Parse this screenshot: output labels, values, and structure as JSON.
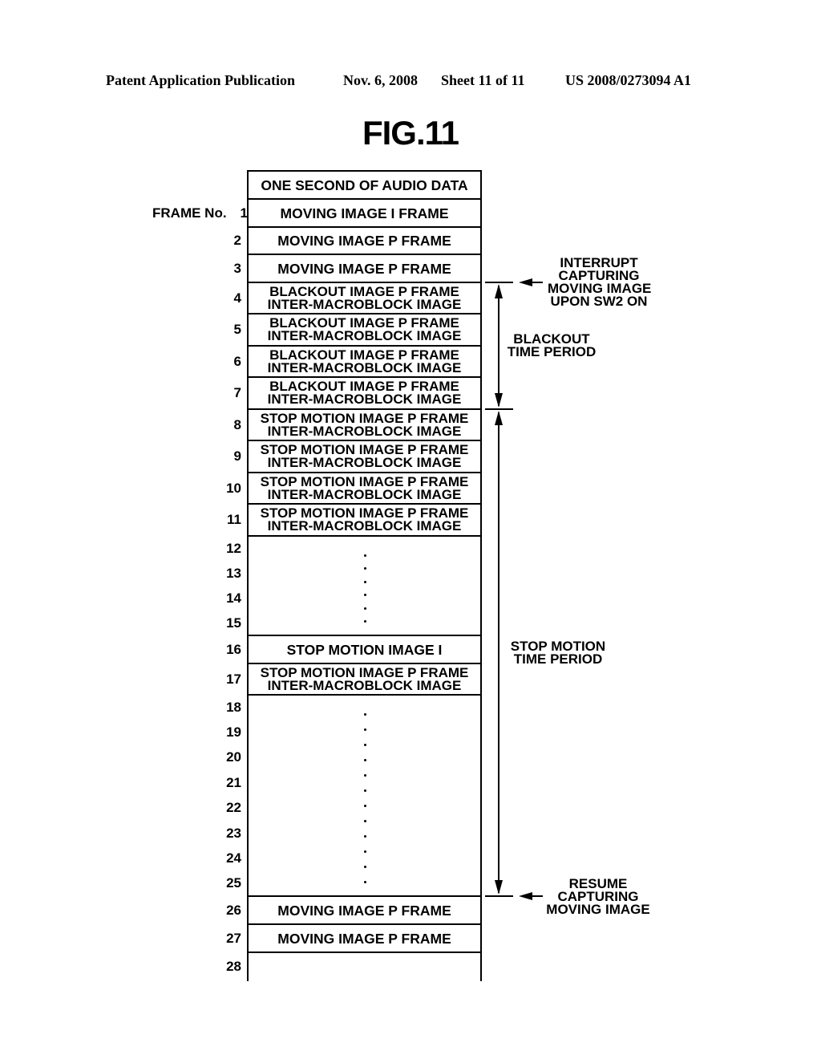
{
  "header": {
    "publication": "Patent Application Publication",
    "date": "Nov. 6, 2008",
    "sheet": "Sheet 11 of 11",
    "number": "US 2008/0273094 A1"
  },
  "figure": {
    "title": "FIG.11",
    "frame_label": "FRAME No.",
    "top_cell": "ONE SECOND OF AUDIO DATA",
    "rows": [
      {
        "frames": [
          "1"
        ],
        "lines": [
          "MOVING IMAGE I FRAME"
        ]
      },
      {
        "frames": [
          "2"
        ],
        "lines": [
          "MOVING IMAGE P FRAME"
        ]
      },
      {
        "frames": [
          "3"
        ],
        "lines": [
          "MOVING IMAGE P FRAME"
        ]
      },
      {
        "frames": [
          "4"
        ],
        "lines": [
          "BLACKOUT IMAGE P FRAME",
          "INTER-MACROBLOCK IMAGE"
        ]
      },
      {
        "frames": [
          "5"
        ],
        "lines": [
          "BLACKOUT IMAGE P FRAME",
          "INTER-MACROBLOCK IMAGE"
        ]
      },
      {
        "frames": [
          "6"
        ],
        "lines": [
          "BLACKOUT IMAGE P FRAME",
          "INTER-MACROBLOCK IMAGE"
        ]
      },
      {
        "frames": [
          "7"
        ],
        "lines": [
          "BLACKOUT IMAGE P FRAME",
          "INTER-MACROBLOCK IMAGE"
        ]
      },
      {
        "frames": [
          "8"
        ],
        "lines": [
          "STOP MOTION IMAGE P FRAME",
          "INTER-MACROBLOCK IMAGE"
        ]
      },
      {
        "frames": [
          "9"
        ],
        "lines": [
          "STOP MOTION IMAGE P FRAME",
          "INTER-MACROBLOCK IMAGE"
        ]
      },
      {
        "frames": [
          "10"
        ],
        "lines": [
          "STOP MOTION IMAGE P FRAME",
          "INTER-MACROBLOCK IMAGE"
        ]
      },
      {
        "frames": [
          "11"
        ],
        "lines": [
          "STOP MOTION IMAGE P FRAME",
          "INTER-MACROBLOCK IMAGE"
        ]
      },
      {
        "frames": [
          "12",
          "13",
          "14",
          "15"
        ],
        "lines": [],
        "ellipsis": true
      },
      {
        "frames": [
          "16"
        ],
        "lines": [
          "STOP MOTION IMAGE I"
        ]
      },
      {
        "frames": [
          "17"
        ],
        "lines": [
          "STOP MOTION IMAGE P FRAME",
          "INTER-MACROBLOCK IMAGE"
        ]
      },
      {
        "frames": [
          "18",
          "19",
          "20",
          "21",
          "22",
          "23",
          "24",
          "25"
        ],
        "lines": [],
        "ellipsis": true
      },
      {
        "frames": [
          "26"
        ],
        "lines": [
          "MOVING IMAGE P FRAME"
        ]
      },
      {
        "frames": [
          "27"
        ],
        "lines": [
          "MOVING IMAGE P FRAME"
        ]
      },
      {
        "frames": [
          "28"
        ],
        "lines": [],
        "open": true
      }
    ],
    "annotations": {
      "interrupt": [
        "INTERRUPT",
        "CAPTURING",
        "MOVING IMAGE",
        "UPON SW2 ON"
      ],
      "blackout_period": [
        "BLACKOUT",
        "TIME PERIOD"
      ],
      "stop_motion_period": [
        "STOP MOTION",
        "TIME PERIOD"
      ],
      "resume": [
        "RESUME",
        "CAPTURING",
        "MOVING IMAGE"
      ]
    }
  }
}
